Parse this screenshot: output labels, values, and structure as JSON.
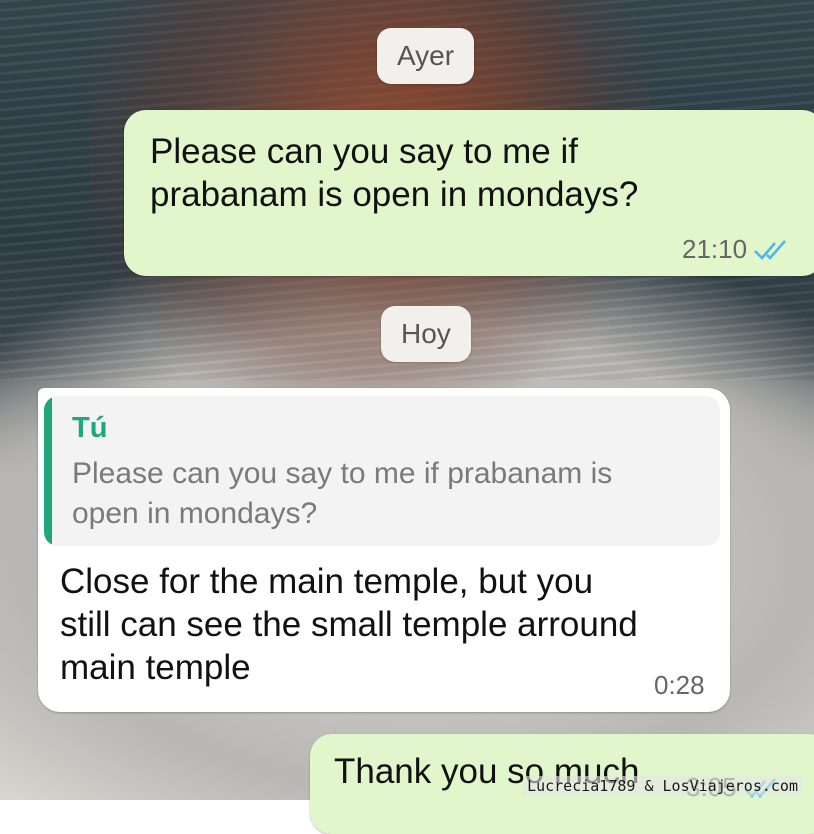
{
  "date_separators": {
    "yesterday": "Ayer",
    "today": "Hoy"
  },
  "messages": [
    {
      "direction": "outgoing",
      "text": "Please can you say to me if prabanam is open in mondays?",
      "line1": "Please can you say to me if",
      "line2": "prabanam is open in mondays?",
      "time": "21:10",
      "status": "read"
    },
    {
      "direction": "incoming",
      "quoted_author": "Tú",
      "quoted_line1": "Please can you say to me if prabanam is",
      "quoted_line2": "open in mondays?",
      "line1": "Close for the main temple, but you",
      "line2": "still can see the small temple arround",
      "line3": "main temple",
      "time": "0:28"
    },
    {
      "direction": "outgoing",
      "text": "Thank you so much",
      "time": "3:05",
      "status": "read"
    }
  ],
  "watermark": "Lucrecia1789 & LosViajeros.com",
  "colors": {
    "outgoing_bubble": "#e1f7cb",
    "incoming_bubble": "#ffffff",
    "quote_accent": "#1fa67a",
    "read_ticks": "#4fb6ec"
  }
}
